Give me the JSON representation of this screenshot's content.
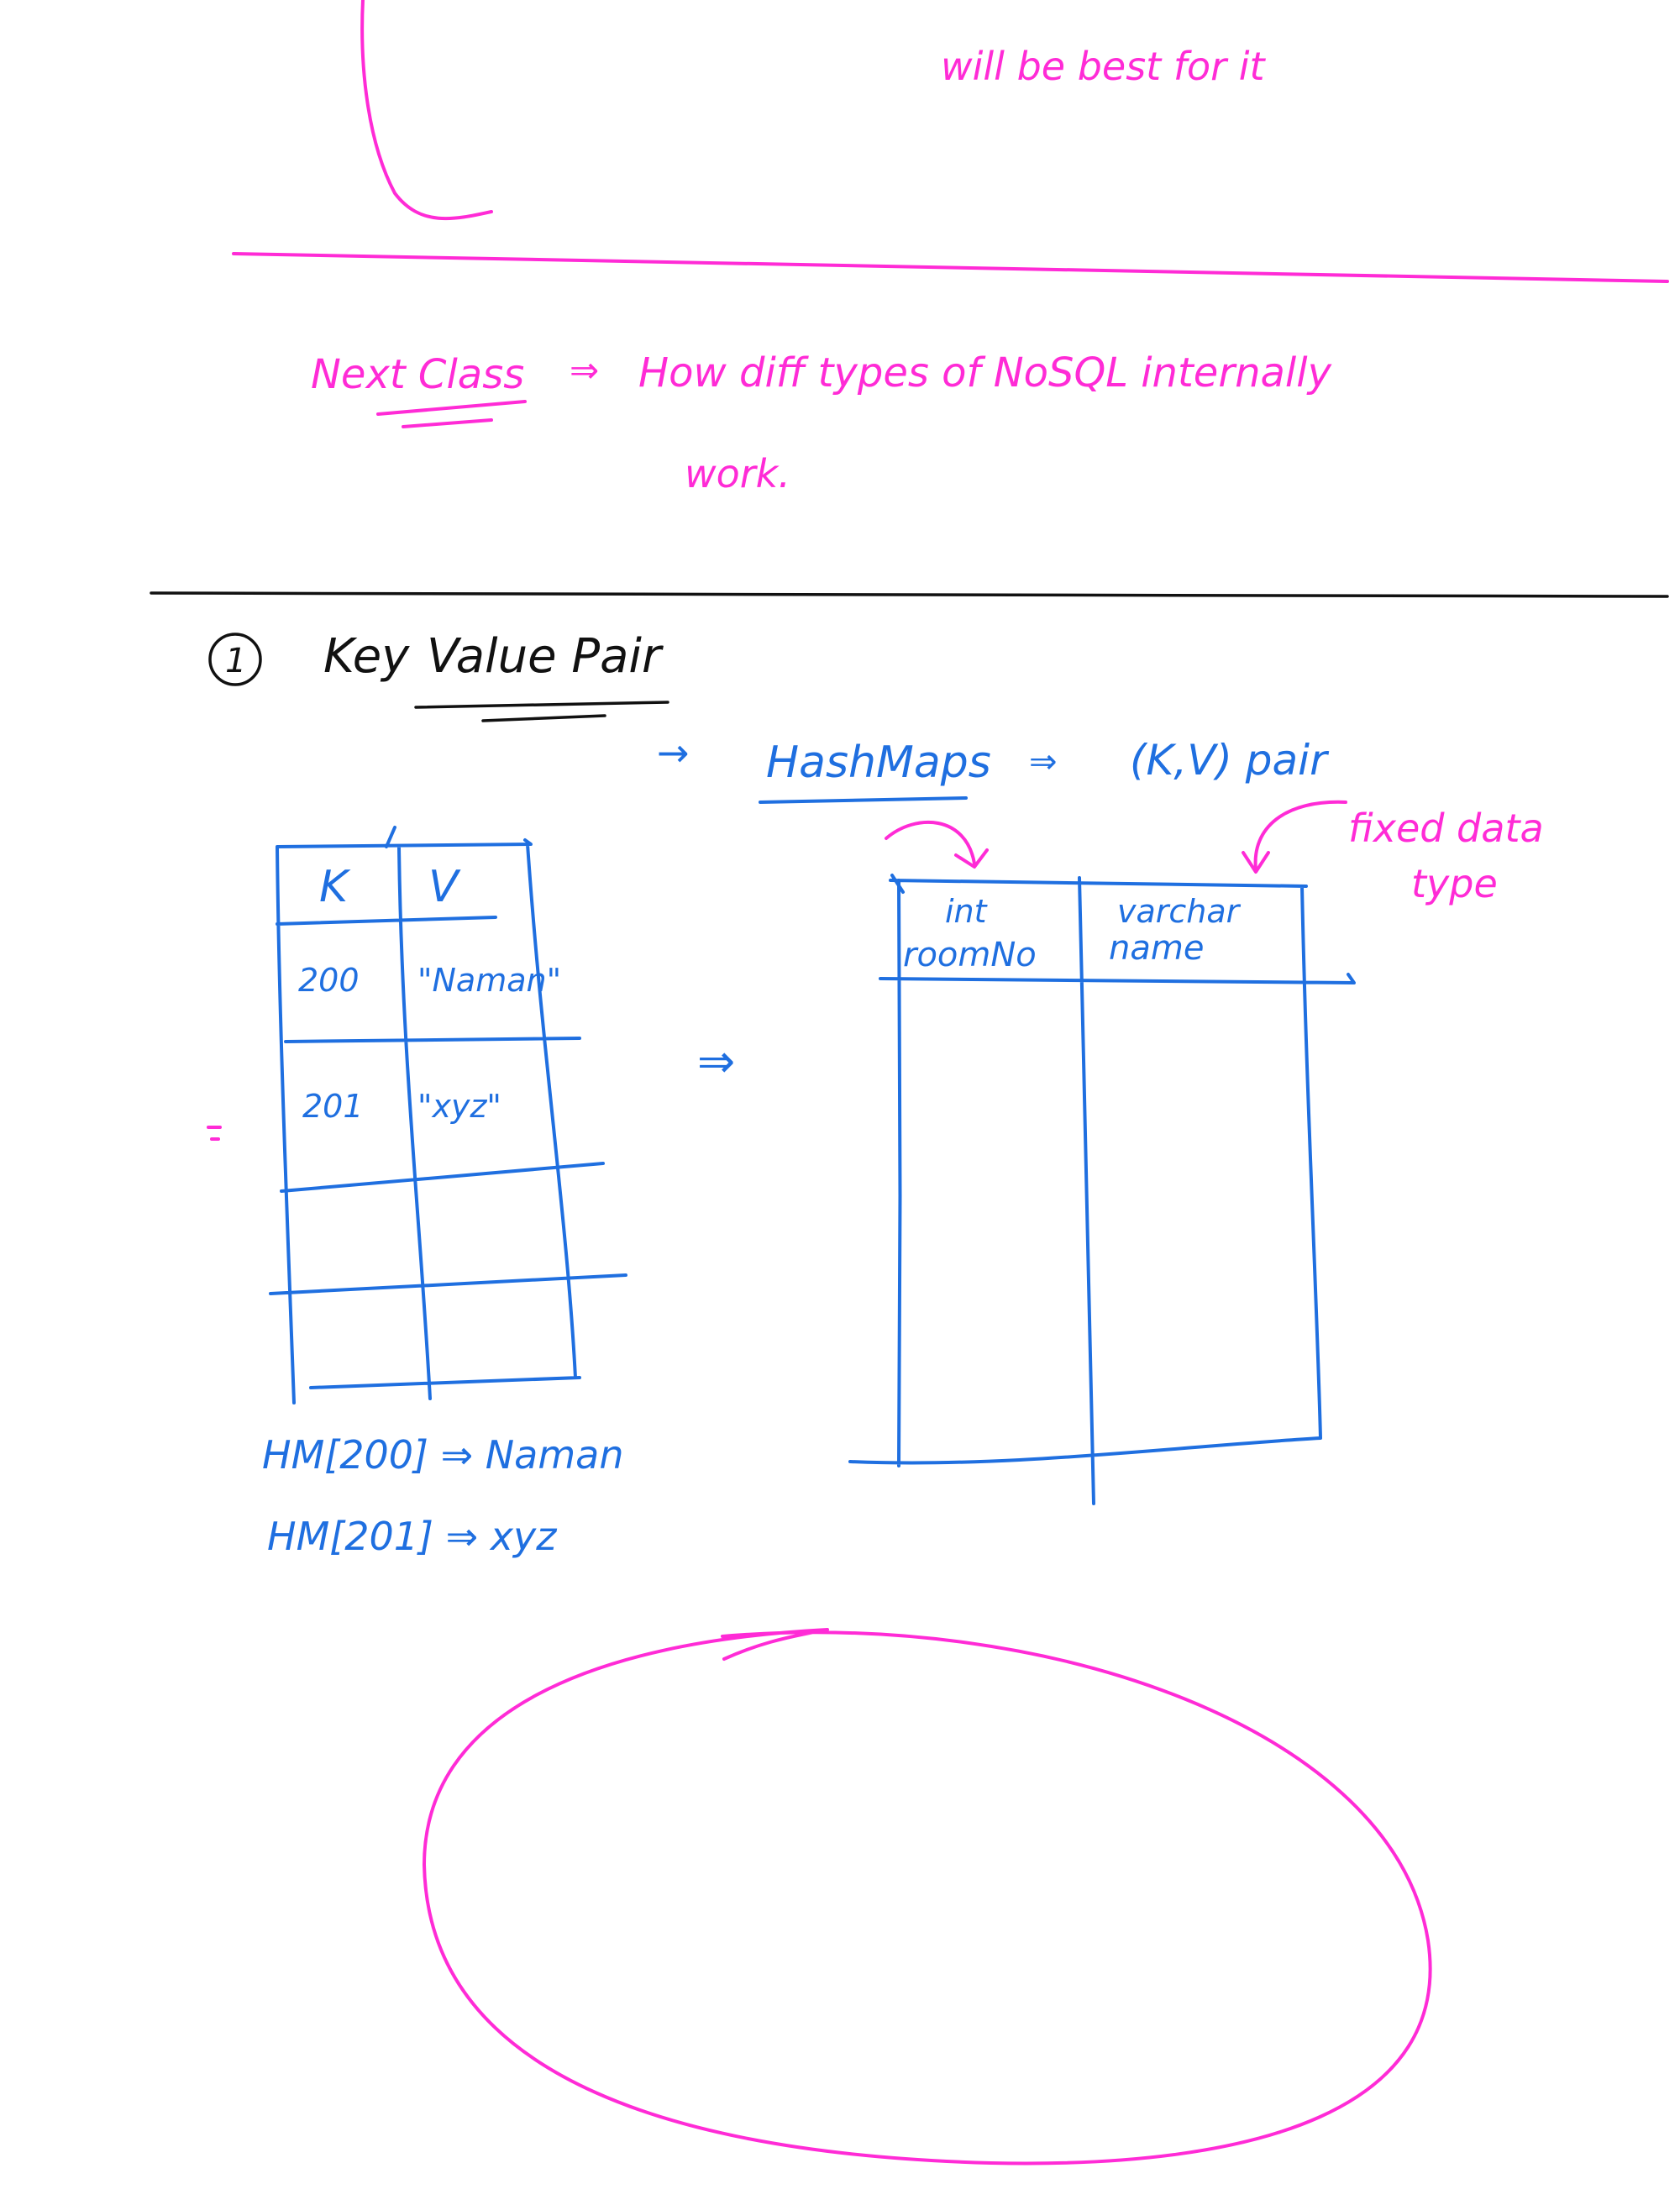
{
  "colors": {
    "pink_ink": "#ff2bd6",
    "blue_ink": "#1f6fe0",
    "dark_ink": "#111111",
    "background": "#ffffff"
  },
  "top_note": {
    "text": "will be best for it"
  },
  "next_class": {
    "label": "Next Class",
    "arrow": "⇒",
    "line1": "How diff types of NoSQL internally",
    "line2": "work."
  },
  "section": {
    "number": "1",
    "title_key": "Key",
    "title_rest": "Value Pair"
  },
  "hashmap_note": {
    "arrow": "→",
    "name": "HashMaps",
    "implies": "⇒",
    "pair": "(K,V) pair",
    "fixed": "fixed data",
    "type": "type"
  },
  "kv_table": {
    "headers": [
      "K",
      "V"
    ],
    "rows": [
      [
        "200",
        "\"Naman\""
      ],
      [
        "201",
        "\"xyz\""
      ]
    ]
  },
  "middle_arrow": "⇒",
  "sql_table": {
    "col1_type": "int",
    "col1_name": "roomNo",
    "col2_type": "varchar",
    "col2_name": "name"
  },
  "lookups": [
    "HM[200] ⇒ Naman",
    "HM[201] ⇒ xyz"
  ]
}
